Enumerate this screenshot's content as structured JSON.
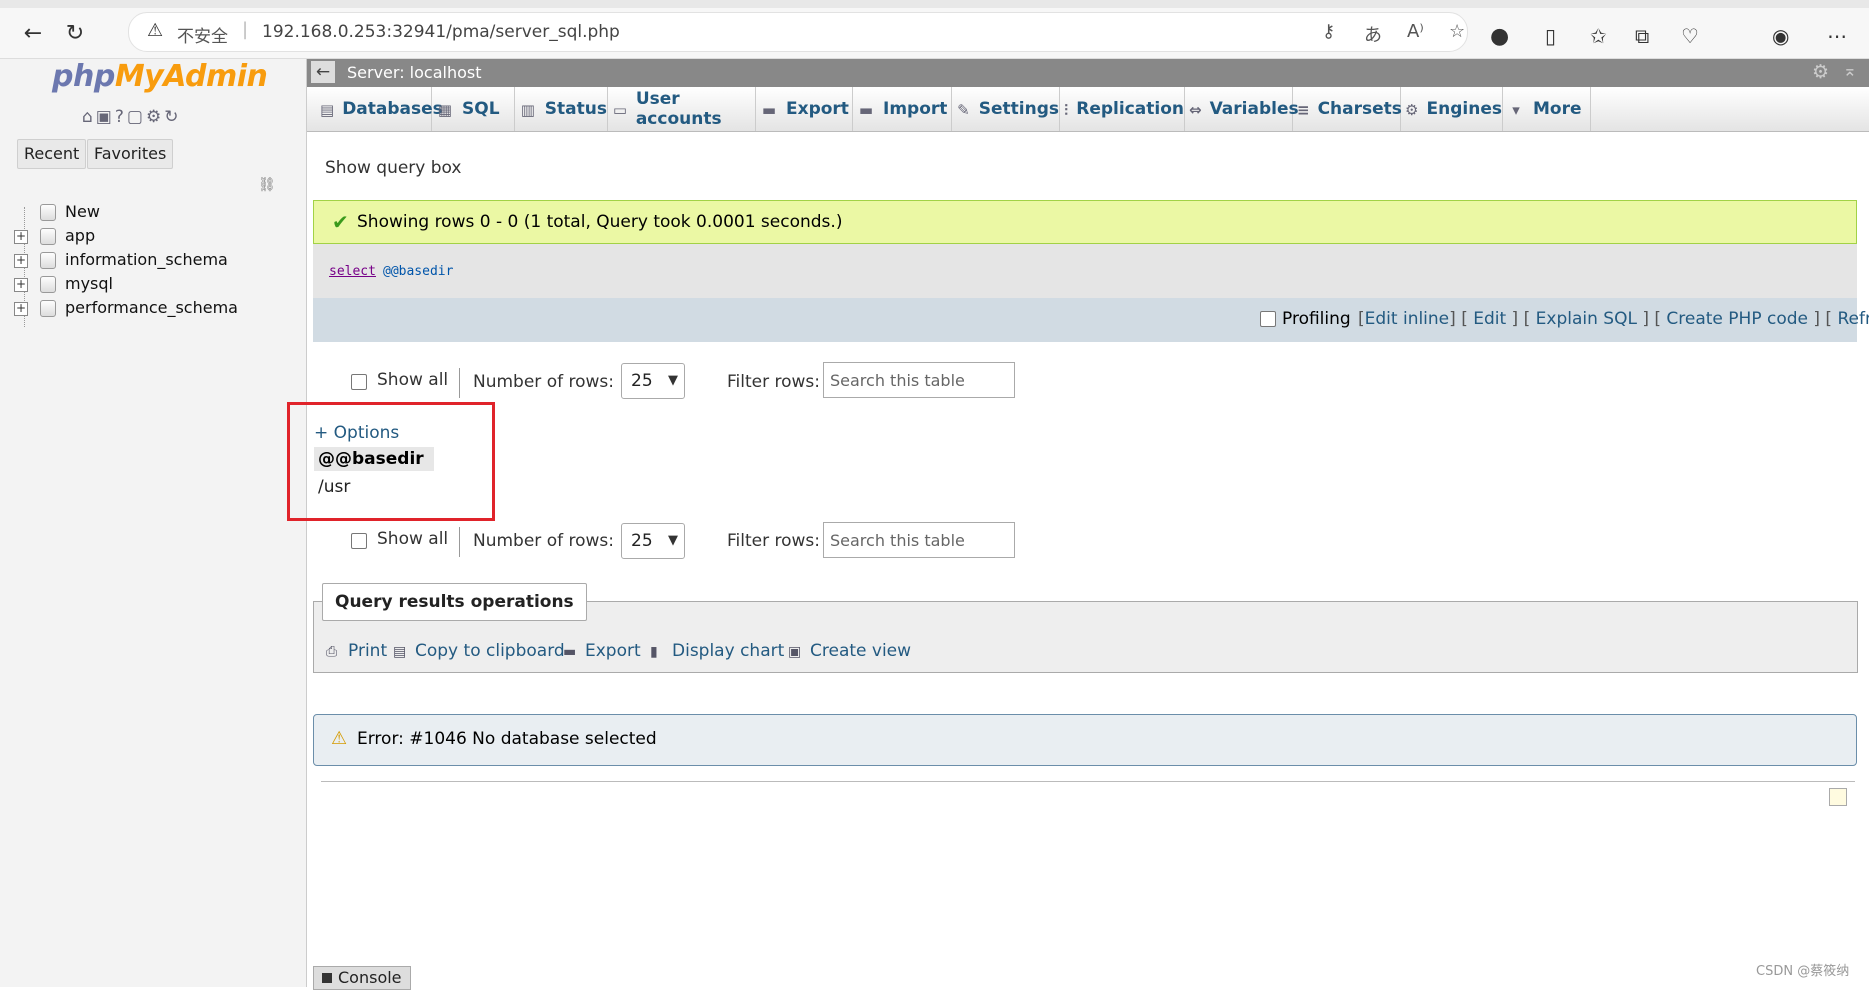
{
  "browser": {
    "security_label": "不安全",
    "url": "192.168.0.253:32941/pma/server_sql.php"
  },
  "sidebar": {
    "logo_php": "php",
    "logo_myadmin": "MyAdmin",
    "tabs": [
      "Recent",
      "Favorites"
    ],
    "tree": [
      {
        "label": "New"
      },
      {
        "label": "app"
      },
      {
        "label": "information_schema"
      },
      {
        "label": "mysql"
      },
      {
        "label": "performance_schema"
      }
    ]
  },
  "serverbar": {
    "label": "Server: localhost"
  },
  "nav": {
    "tabs": [
      {
        "label": "Databases",
        "icon": "database-icon"
      },
      {
        "label": "SQL",
        "icon": "sql-icon"
      },
      {
        "label": "Status",
        "icon": "status-icon"
      },
      {
        "label": "User accounts",
        "icon": "users-icon"
      },
      {
        "label": "Export",
        "icon": "export-icon"
      },
      {
        "label": "Import",
        "icon": "import-icon"
      },
      {
        "label": "Settings",
        "icon": "wrench-icon"
      },
      {
        "label": "Replication",
        "icon": "replication-icon"
      },
      {
        "label": "Variables",
        "icon": "variables-icon"
      },
      {
        "label": "Charsets",
        "icon": "charsets-icon"
      },
      {
        "label": "Engines",
        "icon": "engines-icon"
      },
      {
        "label": "More",
        "icon": "caret-down-icon"
      }
    ]
  },
  "main": {
    "show_query_box": "Show query box",
    "success_message": "Showing rows 0 - 0 (1 total, Query took 0.0001 seconds.)",
    "sql_keyword": "select",
    "sql_variable": "@@basedir",
    "profiling_label": "Profiling",
    "profiling_links": {
      "edit_inline": "Edit inline",
      "edit": "Edit",
      "explain": "Explain SQL",
      "create_php": "Create PHP code",
      "refresh": "Refresh"
    },
    "show_all": "Show all",
    "number_of_rows_label": "Number of rows:",
    "rows_value": "25",
    "filter_rows_label": "Filter rows:",
    "search_placeholder": "Search this table",
    "options_link": "+ Options",
    "column_header": "@@basedir",
    "column_value": "/usr",
    "qro_legend": "Query results operations",
    "operations": [
      {
        "label": "Print",
        "icon": "print-icon"
      },
      {
        "label": "Copy to clipboard",
        "icon": "clipboard-icon"
      },
      {
        "label": "Export",
        "icon": "export-icon"
      },
      {
        "label": "Display chart",
        "icon": "chart-icon"
      },
      {
        "label": "Create view",
        "icon": "view-icon"
      }
    ],
    "error_message": "Error: #1046 No database selected",
    "console_label": "Console"
  },
  "watermark": "CSDN @蔡筱纳",
  "colors": {
    "accent_link": "#235a81",
    "success_bg": "#ebf8a4",
    "highlight_box": "#e0232a"
  }
}
